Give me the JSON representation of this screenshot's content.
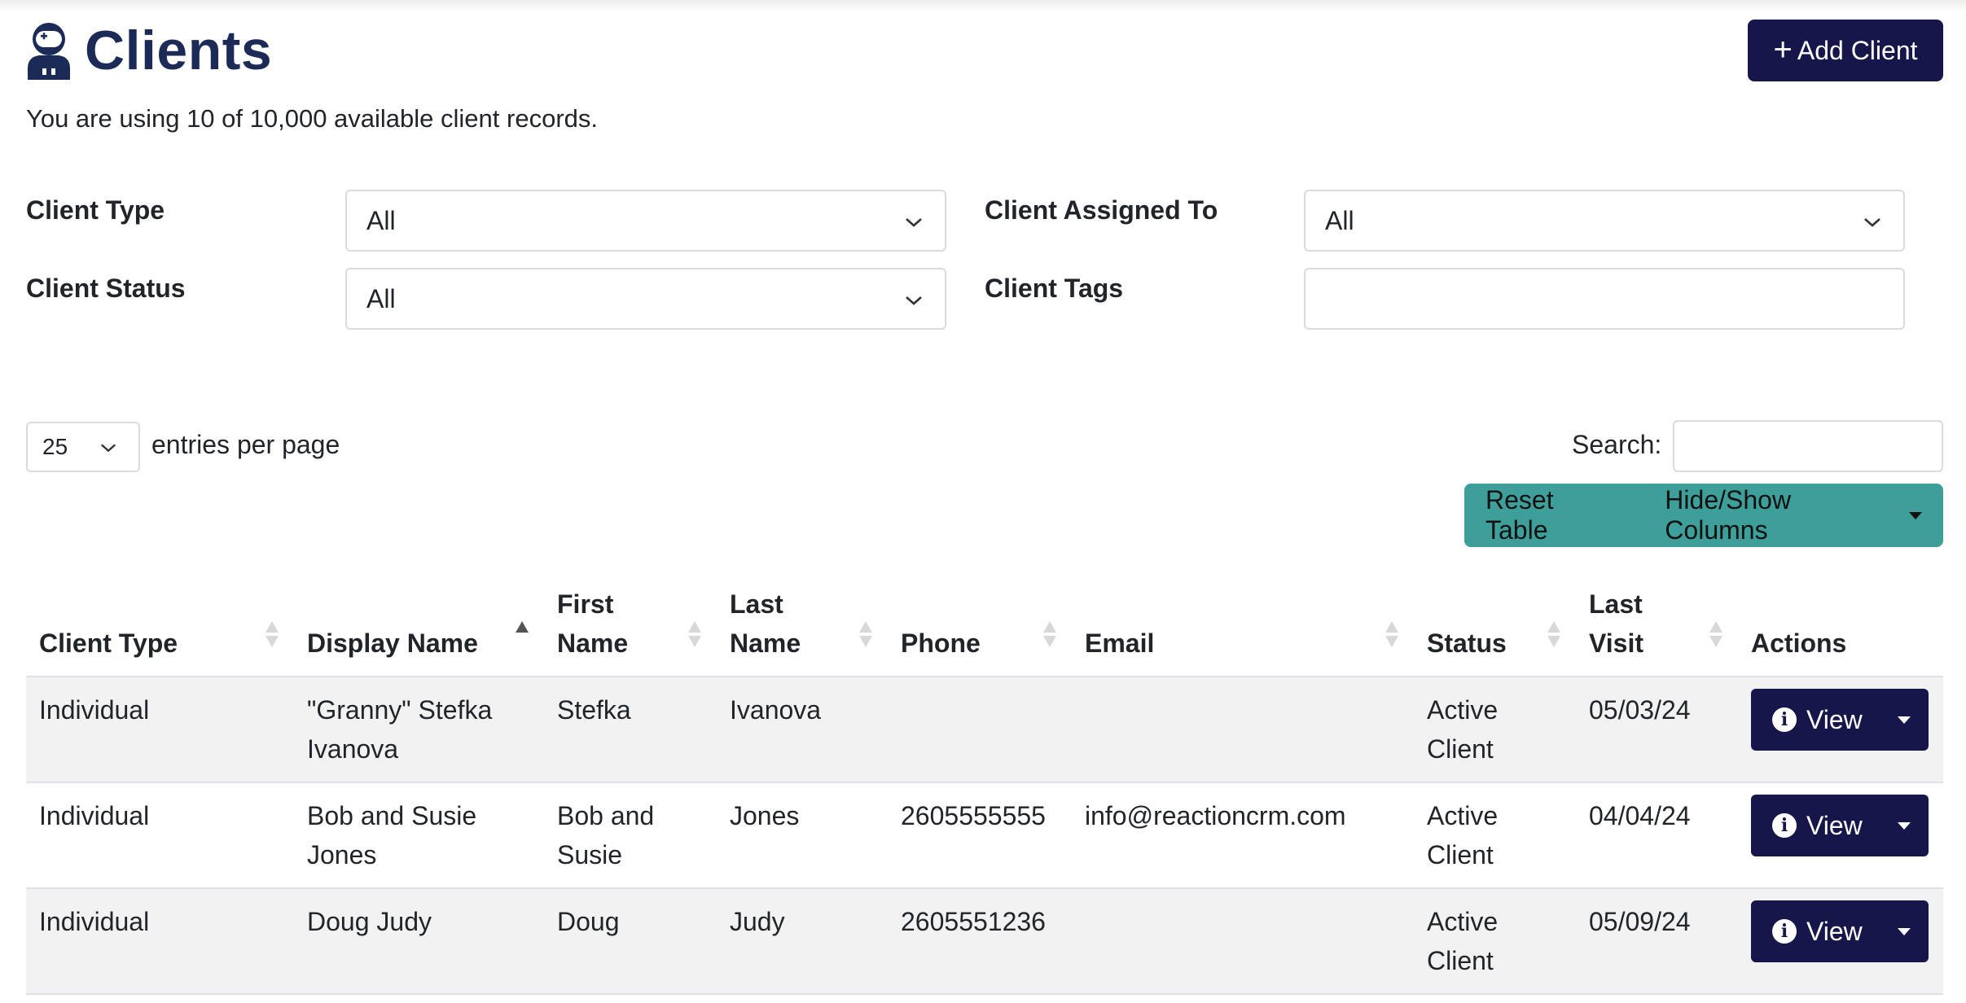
{
  "header": {
    "title": "Clients",
    "title_icon": "user-astronaut-icon",
    "add_button_label": "Add Client",
    "usage_text": "You are using 10 of 10,000 available client records."
  },
  "filters": {
    "client_type": {
      "label": "Client Type",
      "value": "All"
    },
    "client_assigned_to": {
      "label": "Client Assigned To",
      "value": "All"
    },
    "client_status": {
      "label": "Client Status",
      "value": "All"
    },
    "client_tags": {
      "label": "Client Tags",
      "value": ""
    }
  },
  "table_controls": {
    "entries_value": "25",
    "entries_label": "entries per page",
    "search_label": "Search:",
    "search_value": "",
    "reset_label": "Reset Table",
    "columns_label": "Hide/Show Columns"
  },
  "table": {
    "headers": {
      "client_type": "Client Type",
      "display_name": "Display Name",
      "first_name": "First Name",
      "last_name": "Last Name",
      "phone": "Phone",
      "email": "Email",
      "status": "Status",
      "last_visit": "Last Visit",
      "actions": "Actions"
    },
    "sorted_column": "display_name",
    "sort_direction": "ascending",
    "view_label": "View",
    "rows": [
      {
        "client_type": "Individual",
        "display_name": "\"Granny\" Stefka Ivanova",
        "first_name": "Stefka",
        "last_name": "Ivanova",
        "phone": "",
        "email": "",
        "status": "Active Client",
        "last_visit": "05/03/24"
      },
      {
        "client_type": "Individual",
        "display_name": "Bob and Susie Jones",
        "first_name": "Bob and Susie",
        "last_name": "Jones",
        "phone": "2605555555",
        "email": "info@reactioncrm.com",
        "status": "Active Client",
        "last_visit": "04/04/24"
      },
      {
        "client_type": "Individual",
        "display_name": "Doug Judy",
        "first_name": "Doug",
        "last_name": "Judy",
        "phone": "2605551236",
        "email": "",
        "status": "Active Client",
        "last_visit": "05/09/24"
      }
    ]
  },
  "colors": {
    "title": "#1b2a57",
    "primary_button": "#16164a",
    "teal_button_group": "#3d9e9a",
    "striped_row": "#f2f2f2"
  }
}
